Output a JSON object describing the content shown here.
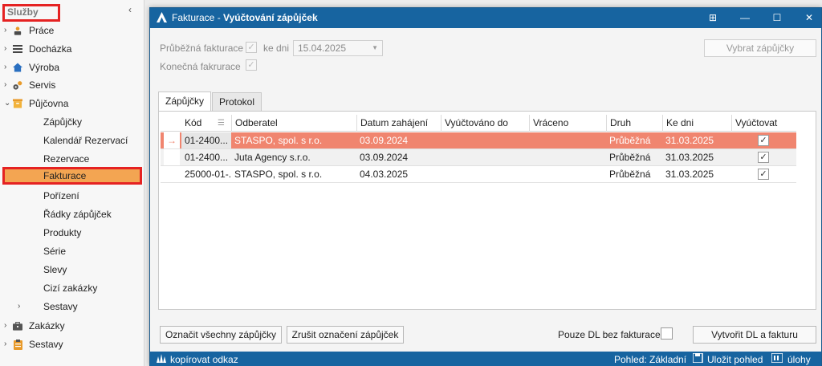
{
  "sidebar": {
    "title": "Služby",
    "collapse": "‹",
    "items": [
      {
        "label": "Práce",
        "arrow": "›",
        "icon": "person-icon"
      },
      {
        "label": "Docházka",
        "arrow": "›",
        "icon": "list-icon"
      },
      {
        "label": "Výroba",
        "arrow": "›",
        "icon": "home-icon"
      },
      {
        "label": "Servis",
        "arrow": "›",
        "icon": "gears-icon"
      },
      {
        "label": "Půjčovna",
        "arrow": "⌄",
        "icon": "box-icon"
      }
    ],
    "subitems": [
      {
        "label": "Zápůjčky"
      },
      {
        "label": "Kalendář Rezervací"
      },
      {
        "label": "Rezervace"
      },
      {
        "label": "Fakturace"
      },
      {
        "label": "Pořízení"
      },
      {
        "label": "Řádky zápůjček"
      },
      {
        "label": "Produkty"
      },
      {
        "label": "Série"
      },
      {
        "label": "Slevy"
      },
      {
        "label": "Cizí zakázky"
      },
      {
        "label": "Sestavy",
        "arrow": "›"
      }
    ],
    "bottom_items": [
      {
        "label": "Zakázky",
        "arrow": "›",
        "icon": "briefcase-icon"
      },
      {
        "label": "Sestavy",
        "arrow": "›",
        "icon": "clipboard-icon"
      }
    ]
  },
  "dialog": {
    "title_prefix": "Fakturace - ",
    "title_main": "Vyúčtování zápůjček",
    "window_buttons": [
      "⊞",
      "—",
      "☐",
      "✕"
    ],
    "form": {
      "prubezna_label": "Průběžná fakturace",
      "ke_dni_label": "ke dni",
      "date_value": "15.04.2025",
      "konecna_label": "Konečná fakrurace",
      "vybrat_button": "Vybrat zápůjčky"
    },
    "tabs": [
      "Zápůjčky",
      "Protokol"
    ],
    "grid": {
      "columns": [
        "Kód",
        "Odberatel",
        "Datum zahájení",
        "Vyúčtováno do",
        "Vráceno",
        "Druh",
        "Ke dni",
        "Vyúčtovat"
      ],
      "rows": [
        {
          "marker": "→",
          "kod": "01-2400...",
          "odberatel": "STASPO, spol. s r.o.",
          "datum": "03.09.2024",
          "vyuctovano": "",
          "vraceno": "",
          "druh": "Průběžná",
          "ke_dni": "31.03.2025",
          "check": "✓"
        },
        {
          "marker": "",
          "kod": "01-2400...",
          "odberatel": "Juta Agency s.r.o.",
          "datum": "03.09.2024",
          "vyuctovano": "",
          "vraceno": "",
          "druh": "Průběžná",
          "ke_dni": "31.03.2025",
          "check": "✓"
        },
        {
          "marker": "",
          "kod": "25000-01-...",
          "odberatel": "STASPO, spol. s r.o.",
          "datum": "04.03.2025",
          "vyuctovano": "",
          "vraceno": "",
          "druh": "Průběžná",
          "ke_dni": "31.03.2025",
          "check": "✓"
        }
      ]
    },
    "buttons": {
      "oznacit": "Označit všechny zápůjčky",
      "zrusit": "Zrušit označení zápůjček",
      "pouze_dl": "Pouze DL bez fakturace",
      "vytvorit": "Vytvořit DL a fakturu"
    },
    "statusbar": {
      "copy_link": "kopírovat odkaz",
      "pohled": "Pohled: Základní",
      "ulozit": "Uložit pohled",
      "ulohy": "úlohy"
    }
  },
  "colors": {
    "accent": "#1764a0",
    "selected_row": "#f0856f",
    "sidebar_selected": "#f3a552",
    "highlight_border": "#e52222"
  }
}
